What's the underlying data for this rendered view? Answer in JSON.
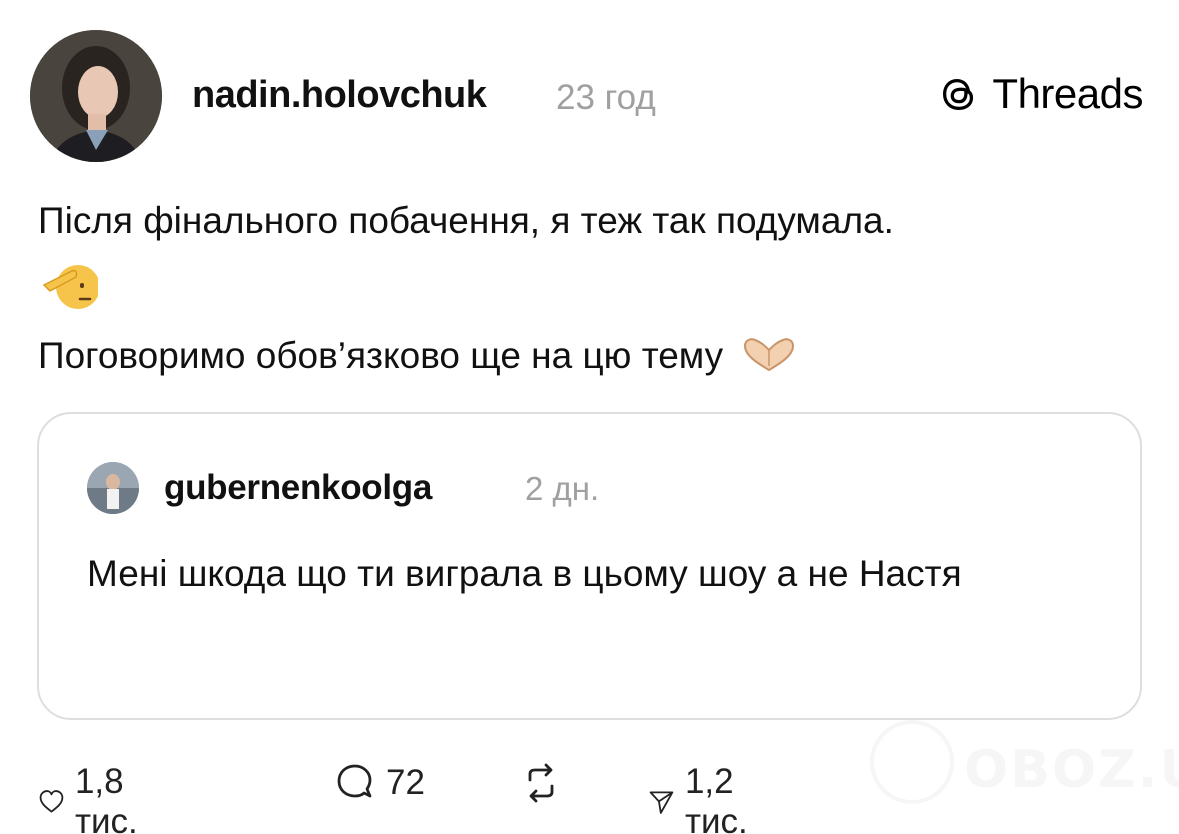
{
  "post": {
    "username": "nadin.holovchuk",
    "time": "23 год",
    "line1": "Після фінального побачення, я теж так подумала.",
    "line2": "Поговоримо обов’язково ще на цю тему"
  },
  "brand": {
    "name": "Threads",
    "icon": "threads-logo"
  },
  "quote": {
    "username": "gubernenkoolga",
    "time": "2 дн.",
    "text": "Мені шкода що ти виграла в цьому шоу а не Настя"
  },
  "actions": {
    "likes": "1,8 тис.",
    "replies": "72",
    "shares": "1,2 тис."
  },
  "watermark": {
    "text": "OBOZ.UA"
  }
}
